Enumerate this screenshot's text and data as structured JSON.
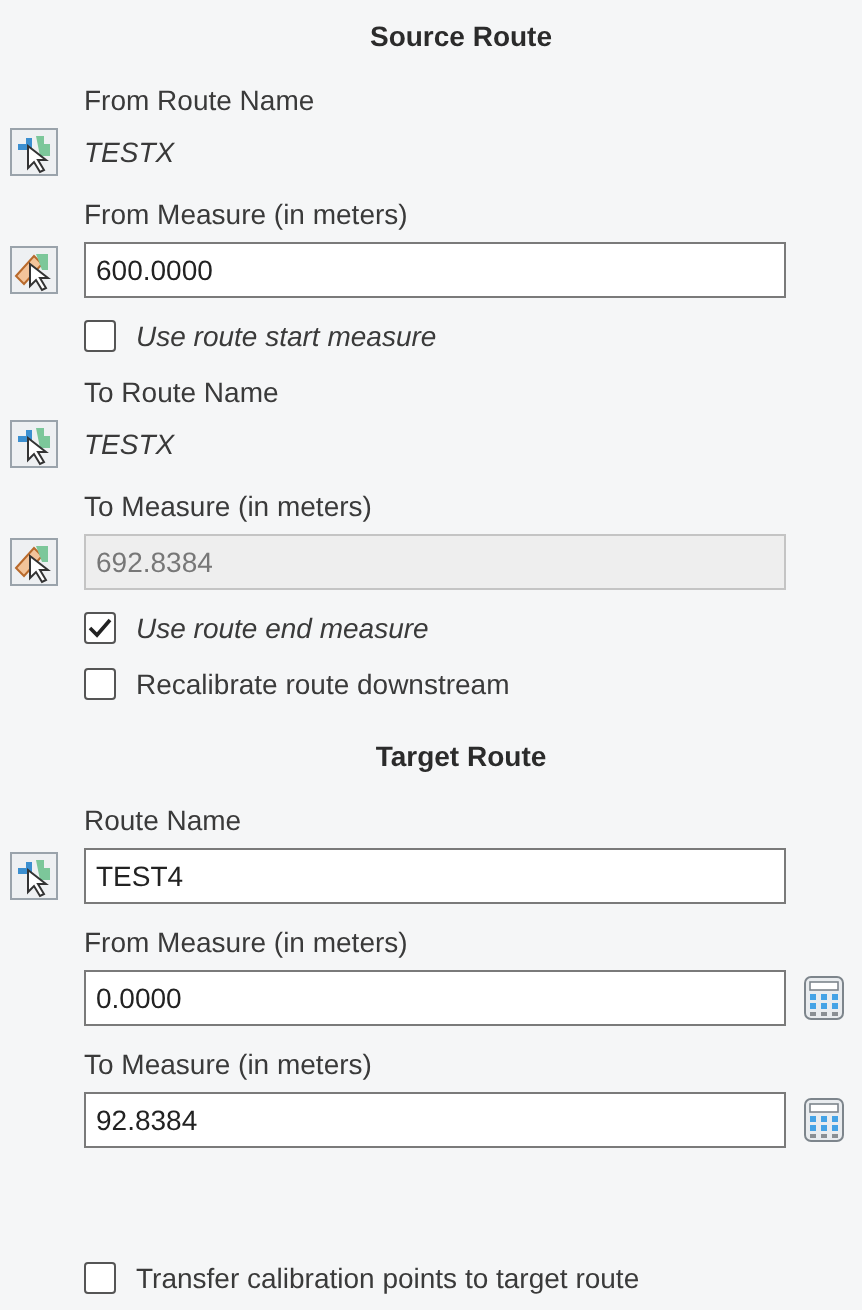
{
  "sections": [
    {
      "title": "Source Route",
      "items": [
        {
          "kind": "route",
          "label": "From Route Name",
          "value": "TESTX"
        },
        {
          "kind": "measure_field",
          "label": "From Measure (in meters)",
          "value": "600.0000",
          "disabled": false
        },
        {
          "kind": "checkbox",
          "label": "Use route start measure",
          "checked": false,
          "italic": true
        },
        {
          "kind": "route",
          "label": "To Route Name",
          "value": "TESTX"
        },
        {
          "kind": "measure_field",
          "label": "To Measure (in meters)",
          "value": "692.8384",
          "disabled": true
        },
        {
          "kind": "checkbox",
          "label": "Use route end measure",
          "checked": true,
          "italic": true
        },
        {
          "kind": "checkbox",
          "label": "Recalibrate route downstream",
          "checked": false,
          "italic": false
        }
      ]
    },
    {
      "title": "Target Route",
      "items": [
        {
          "kind": "pick_field",
          "label": "Route Name",
          "value": "TEST4",
          "disabled": false
        },
        {
          "kind": "calc_field",
          "label": "From Measure (in meters)",
          "value": "0.0000",
          "disabled": false
        },
        {
          "kind": "calc_field",
          "label": "To Measure (in meters)",
          "value": "92.8384",
          "disabled": false
        },
        {
          "kind": "gap"
        },
        {
          "kind": "checkbox",
          "label": "Transfer calibration points to target route",
          "checked": false,
          "italic": false
        }
      ]
    }
  ]
}
